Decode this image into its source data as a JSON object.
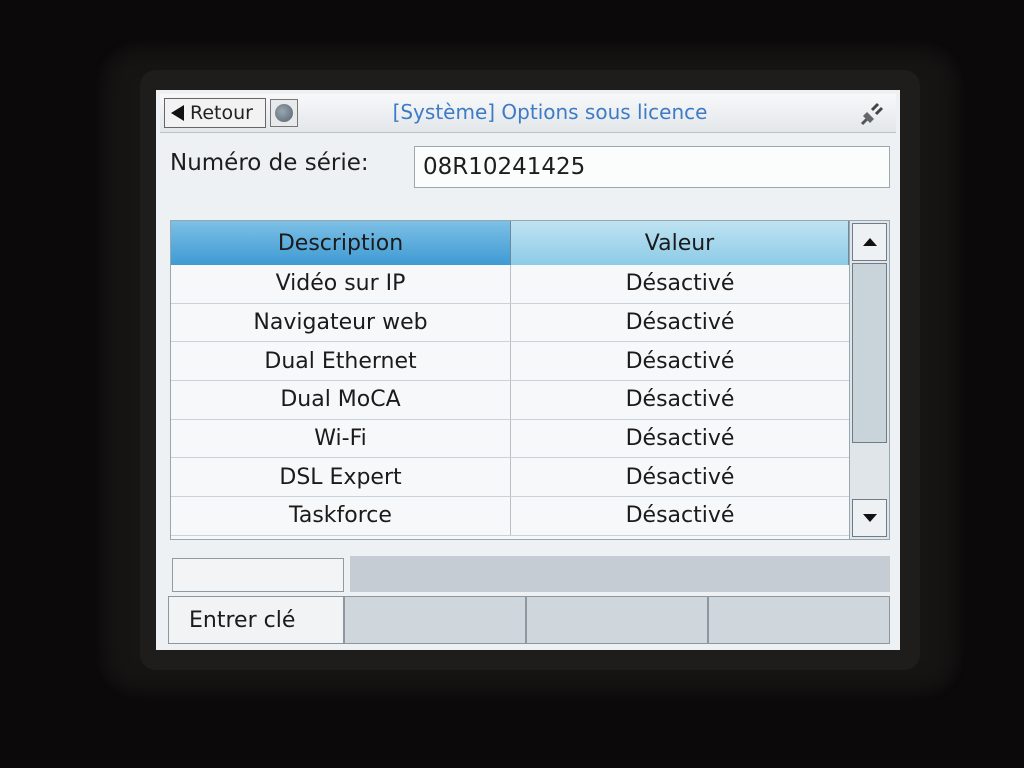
{
  "header": {
    "back_label": "Retour",
    "title": "[Système] Options sous licence"
  },
  "serial": {
    "label": "Numéro de série:",
    "value": "08R10241425"
  },
  "table": {
    "columns": [
      "Description",
      "Valeur"
    ],
    "rows": [
      {
        "description": "Vidéo sur IP",
        "value": "Désactivé"
      },
      {
        "description": "Navigateur web",
        "value": "Désactivé"
      },
      {
        "description": "Dual Ethernet",
        "value": "Désactivé"
      },
      {
        "description": "Dual MoCA",
        "value": "Désactivé"
      },
      {
        "description": "Wi-Fi",
        "value": "Désactivé"
      },
      {
        "description": "DSL Expert",
        "value": "Désactivé"
      },
      {
        "description": "Taskforce",
        "value": "Désactivé"
      }
    ]
  },
  "softkeys": [
    "Entrer clé",
    "",
    "",
    ""
  ],
  "icons": {
    "back": "left-arrow-icon",
    "refresh": "refresh-icon",
    "power": "plug-icon",
    "scroll_up": "scroll-up-icon",
    "scroll_down": "scroll-down-icon"
  },
  "colors": {
    "title": "#3d7bc4",
    "header_col1": "#3f9ad3",
    "header_col2": "#8ccbe6"
  }
}
